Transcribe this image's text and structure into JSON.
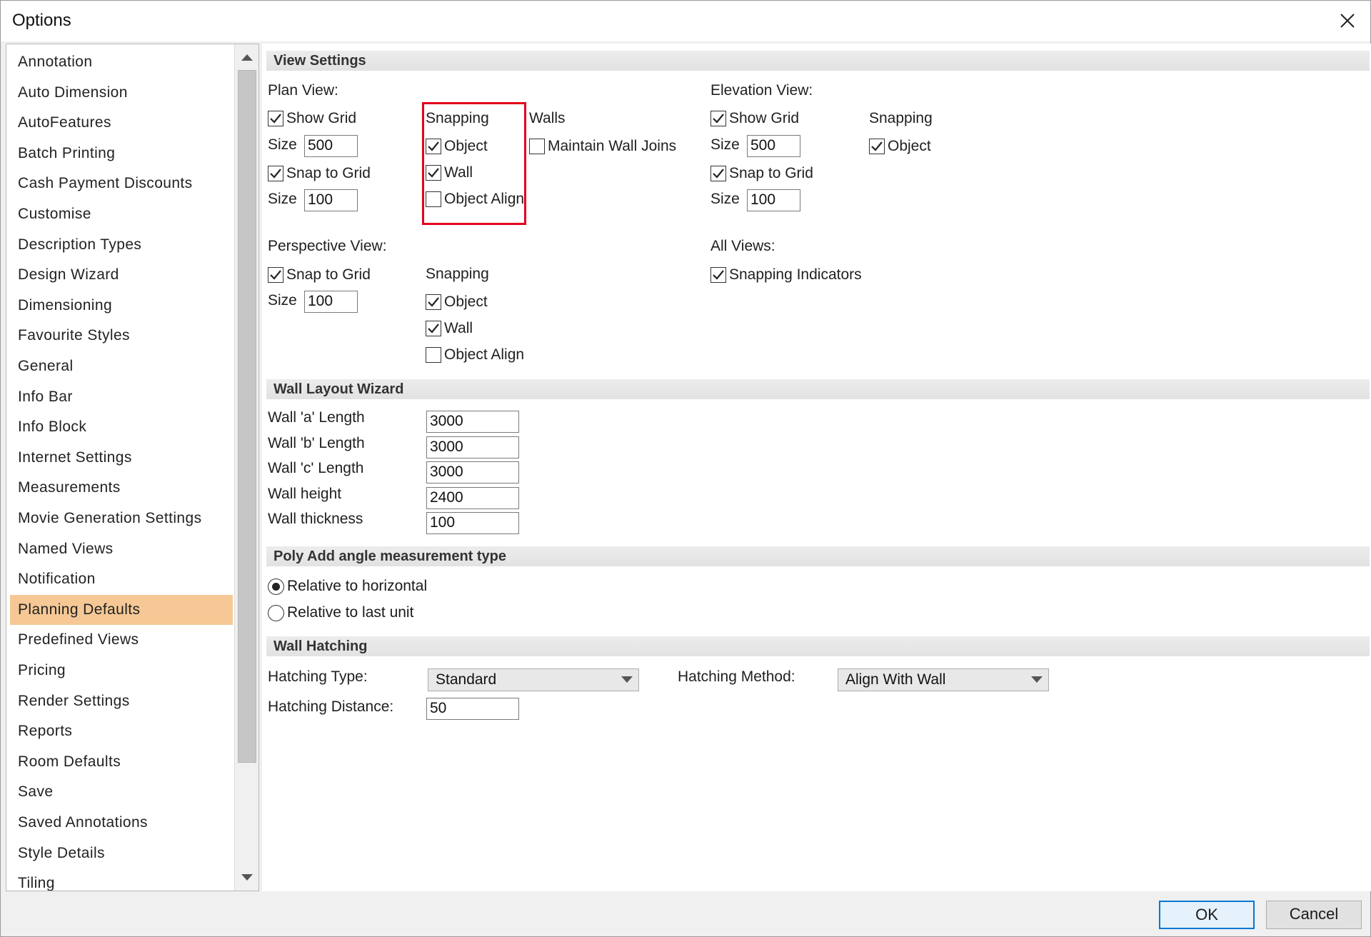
{
  "window": {
    "title": "Options"
  },
  "nav": {
    "items": [
      "Annotation",
      "Auto Dimension",
      "AutoFeatures",
      "Batch Printing",
      "Cash Payment Discounts",
      "Customise",
      "Description Types",
      "Design Wizard",
      "Dimensioning",
      "Favourite Styles",
      "General",
      "Info Bar",
      "Info Block",
      "Internet Settings",
      "Measurements",
      "Movie Generation Settings",
      "Named Views",
      "Notification",
      "Planning Defaults",
      "Predefined Views",
      "Pricing",
      "Render Settings",
      "Reports",
      "Room Defaults",
      "Save",
      "Saved Annotations",
      "Style Details",
      "Tiling"
    ],
    "selected": "Planning Defaults"
  },
  "view_settings": {
    "header": "View Settings",
    "plan": {
      "label": "Plan View:",
      "show_grid": {
        "label": "Show Grid",
        "checked": true
      },
      "size1_label": "Size",
      "size1_value": "500",
      "snap_to_grid": {
        "label": "Snap to Grid",
        "checked": true
      },
      "size2_label": "Size",
      "size2_value": "100",
      "snapping_label": "Snapping",
      "object": {
        "label": "Object",
        "checked": true
      },
      "wall": {
        "label": "Wall",
        "checked": true
      },
      "object_align": {
        "label": "Object Align",
        "checked": false
      },
      "walls_label": "Walls",
      "maintain_wall_joins": {
        "label": "Maintain Wall Joins",
        "checked": false
      }
    },
    "elevation": {
      "label": "Elevation View:",
      "show_grid": {
        "label": "Show Grid",
        "checked": true
      },
      "size1_label": "Size",
      "size1_value": "500",
      "snap_to_grid": {
        "label": "Snap to Grid",
        "checked": true
      },
      "size2_label": "Size",
      "size2_value": "100",
      "snapping_label": "Snapping",
      "object": {
        "label": "Object",
        "checked": true
      }
    },
    "perspective": {
      "label": "Perspective View:",
      "snap_to_grid": {
        "label": "Snap to Grid",
        "checked": true
      },
      "size_label": "Size",
      "size_value": "100",
      "snapping_label": "Snapping",
      "object": {
        "label": "Object",
        "checked": true
      },
      "wall": {
        "label": "Wall",
        "checked": true
      },
      "object_align": {
        "label": "Object Align",
        "checked": false
      }
    },
    "all_views": {
      "label": "All Views:",
      "snapping_indicators": {
        "label": "Snapping Indicators",
        "checked": true
      }
    }
  },
  "wall_layout": {
    "header": "Wall Layout Wizard",
    "fields": [
      {
        "label": "Wall 'a' Length",
        "value": "3000"
      },
      {
        "label": "Wall 'b' Length",
        "value": "3000"
      },
      {
        "label": "Wall 'c' Length",
        "value": "3000"
      },
      {
        "label": "Wall height",
        "value": "2400"
      },
      {
        "label": "Wall thickness",
        "value": "100"
      }
    ]
  },
  "poly_add": {
    "header": "Poly Add angle measurement type",
    "options": [
      {
        "label": "Relative to horizontal",
        "selected": true
      },
      {
        "label": "Relative to last unit",
        "selected": false
      }
    ]
  },
  "wall_hatching": {
    "header": "Wall Hatching",
    "type_label": "Hatching Type:",
    "type_value": "Standard",
    "method_label": "Hatching Method:",
    "method_value": "Align With Wall",
    "distance_label": "Hatching Distance:",
    "distance_value": "50"
  },
  "buttons": {
    "ok": "OK",
    "cancel": "Cancel"
  },
  "colors": {
    "selected_item": "#f5c895",
    "highlight_box": "#e3001b",
    "default_button": "#0078d7"
  }
}
